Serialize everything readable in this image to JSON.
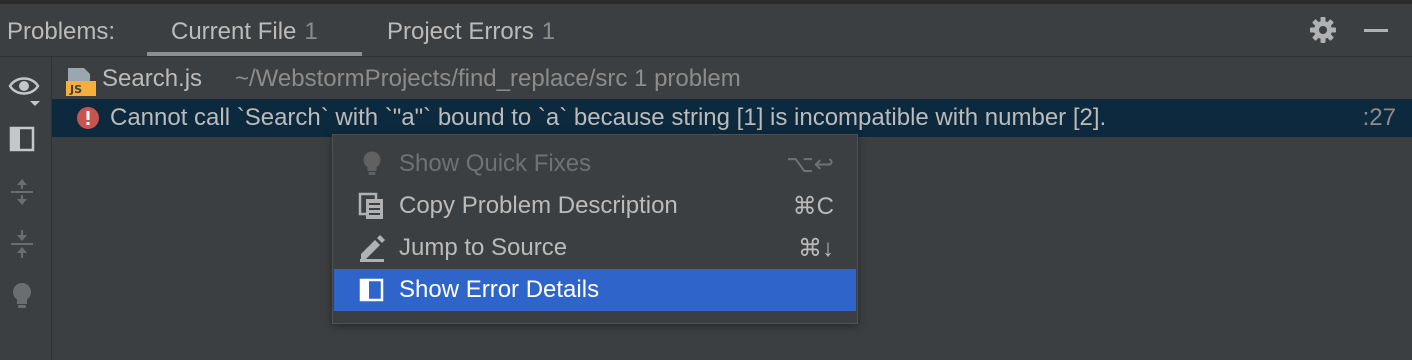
{
  "header": {
    "problems_label": "Problems:",
    "tabs": [
      {
        "label": "Current File",
        "count": "1",
        "active": true
      },
      {
        "label": "Project Errors",
        "count": "1",
        "active": false
      }
    ],
    "icons": [
      "gear-icon",
      "minimize-icon"
    ]
  },
  "sidebar": {
    "icons": [
      "eye-icon",
      "preview-toggle-icon",
      "expand-all-icon",
      "collapse-all-icon",
      "lightbulb-icon"
    ]
  },
  "tree": {
    "file": {
      "icon": "js-file-icon",
      "name": "Search.js",
      "path_and_count": "~/WebstormProjects/find_replace/src  1 problem"
    },
    "problem": {
      "icon": "error-icon",
      "text": "Cannot call `Search` with `\"a\"` bound to `a` because  string [1] is incompatible with  number [2].",
      "line": ":27"
    }
  },
  "context_menu": {
    "items": [
      {
        "label": "Show Quick Fixes",
        "shortcut": "⌥↩",
        "icon": "lightbulb-icon",
        "enabled": false,
        "selected": false
      },
      {
        "label": "Copy Problem Description",
        "shortcut": "⌘C",
        "icon": "copy-icon",
        "enabled": true,
        "selected": false
      },
      {
        "label": "Jump to Source",
        "shortcut": "⌘↓",
        "icon": "edit-pencil-icon",
        "enabled": true,
        "selected": false
      },
      {
        "label": "Show Error Details",
        "shortcut": "",
        "icon": "details-panel-icon",
        "enabled": true,
        "selected": true
      }
    ]
  },
  "colors": {
    "background": "#3c3f41",
    "selection_row": "#0d293e",
    "menu_selection": "#2f65ca",
    "error_red": "#c75450",
    "text": "#bbbbbb",
    "muted_text": "#8c8c8c"
  }
}
